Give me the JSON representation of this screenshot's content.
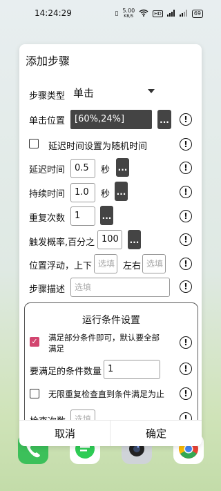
{
  "status": {
    "time": "14:24:29",
    "network_speed_value": "5.00",
    "network_speed_unit": "KB/S",
    "sim": "HD",
    "battery": "69"
  },
  "dialog": {
    "title": "添加步骤",
    "step_type": {
      "label": "步骤类型",
      "value": "单击"
    },
    "click_position": {
      "label": "单击位置",
      "value": "[60%,24%]",
      "more": "..."
    },
    "random_delay": {
      "label": "延迟时间设置为随机时间",
      "checked": false
    },
    "delay": {
      "label": "延迟时间",
      "value": "0.5",
      "unit": "秒",
      "more": "..."
    },
    "duration": {
      "label": "持续时间",
      "value": "1.0",
      "unit": "秒",
      "more": "..."
    },
    "repeat": {
      "label": "重复次数",
      "value": "1",
      "more": "..."
    },
    "probability": {
      "label": "触发概率,百分之",
      "value": "100",
      "more": "..."
    },
    "offset": {
      "label": "位置浮动，上下",
      "vertical_placeholder": "选填",
      "horizontal_label": "左右",
      "horizontal_placeholder": "选填"
    },
    "description": {
      "label": "步骤描述",
      "placeholder": "选填"
    },
    "conditions": {
      "title": "运行条件设置",
      "partial": {
        "label_line1": "满足部分条件即可，默认要全部",
        "label_line2": "满足",
        "checked": true
      },
      "required_count": {
        "label": "要满足的条件数量",
        "value": "1"
      },
      "infinite": {
        "label": "无限重复检查直到条件满足为止",
        "checked": false
      },
      "check_count": {
        "label": "检查次数",
        "placeholder": "选填"
      }
    },
    "cancel": "取消",
    "confirm": "确定",
    "info_glyph": "!"
  },
  "colors": {
    "checkbox_on": "#d2456f",
    "dark_button": "#444444"
  }
}
